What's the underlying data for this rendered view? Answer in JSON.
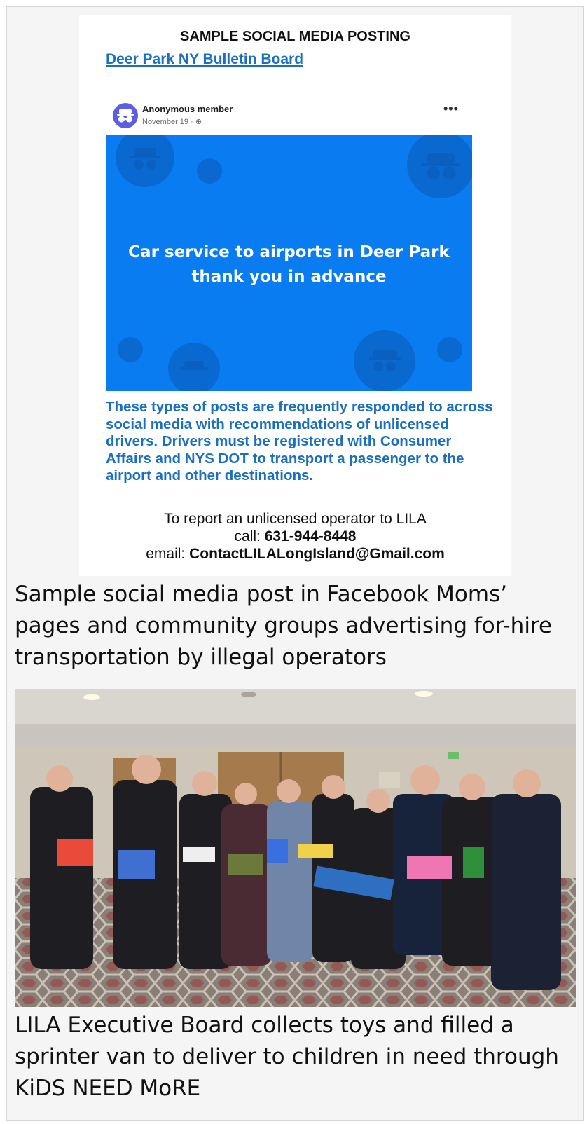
{
  "sample_post": {
    "heading": "SAMPLE SOCIAL MEDIA POSTING",
    "group_link": "Deer Park NY Bulletin Board",
    "author": "Anonymous member",
    "meta": "November 19 · ",
    "more_icon": "more-options-icon",
    "image_text_line1": "Car service to airports in Deer Park",
    "image_text_line2": "thank you in advance",
    "image_bg_color": "#0a7cf2",
    "warning": "These types of posts are frequently responded to across social media with recommendations of unlicensed drivers. Drivers must be registered with Consumer Affairs and NYS DOT to transport a passenger to the airport and other destinations.",
    "report_line": "To report an unlicensed operator to LILA",
    "call_label": "call: ",
    "phone": "631-944-8448",
    "email_label": "email: ",
    "email": "ContactLILALongIsland@Gmail.com"
  },
  "captions": {
    "first": "Sample social media post in Facebook Moms’ pages and community groups advertising for-hire transportation by illegal operators",
    "second": "LILA Executive Board collects toys and filled a sprinter van to deliver to children in need through KiDS NEED MoRE"
  },
  "colors": {
    "link_blue": "#1a6fc0",
    "facebook_blue": "#0a7cf2",
    "page_bg": "#f5f5f5"
  }
}
